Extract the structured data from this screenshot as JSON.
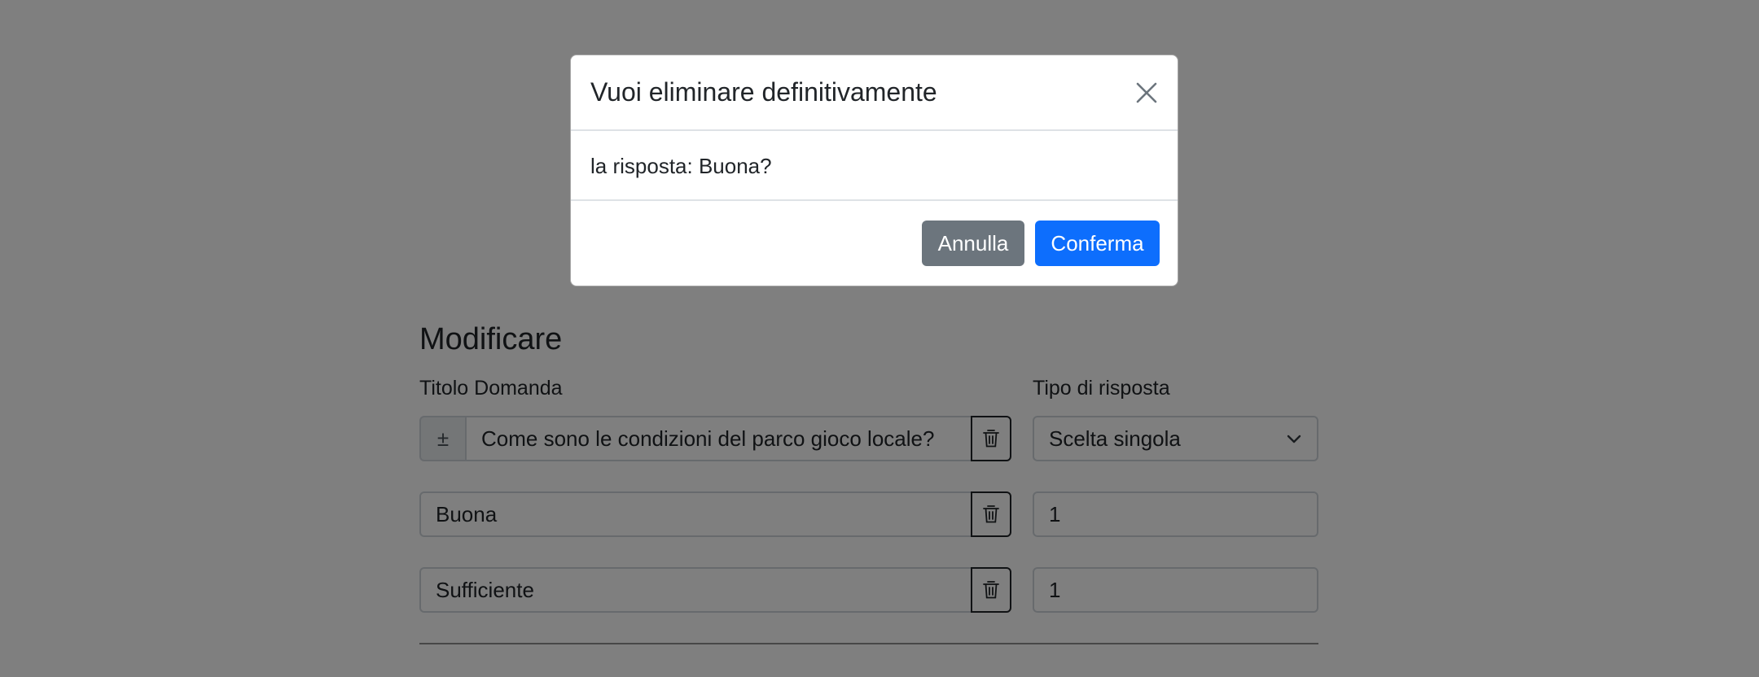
{
  "page": {
    "section_title": "Modificare",
    "labels": {
      "question_title": "Titolo Domanda",
      "answer_type": "Tipo di risposta"
    },
    "question_row": {
      "addon_symbol": "±",
      "value": "Come sono le condizioni del parco gioco locale?",
      "answer_type_selected": "Scelta singola"
    },
    "answers": [
      {
        "text": "Buona",
        "score": "1"
      },
      {
        "text": "Sufficiente",
        "score": "1"
      }
    ]
  },
  "modal": {
    "title": "Vuoi eliminare definitivamente",
    "body": "la risposta: Buona?",
    "cancel_label": "Annulla",
    "confirm_label": "Conferma"
  },
  "colors": {
    "backdrop": "#000000",
    "confirm": "#0d6efd",
    "cancel": "#6c757d"
  },
  "icons": {
    "close": "close-icon",
    "trash": "trash-icon",
    "chevron": "chevron-down-icon",
    "plusminus": "plus-minus-icon"
  }
}
